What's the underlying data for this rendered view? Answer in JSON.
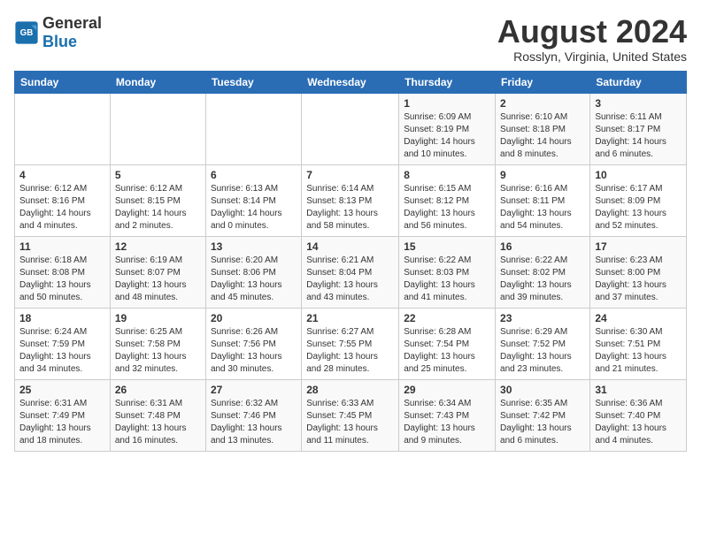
{
  "logo": {
    "general": "General",
    "blue": "Blue"
  },
  "title": "August 2024",
  "subtitle": "Rosslyn, Virginia, United States",
  "days_of_week": [
    "Sunday",
    "Monday",
    "Tuesday",
    "Wednesday",
    "Thursday",
    "Friday",
    "Saturday"
  ],
  "weeks": [
    [
      {
        "day": "",
        "info": ""
      },
      {
        "day": "",
        "info": ""
      },
      {
        "day": "",
        "info": ""
      },
      {
        "day": "",
        "info": ""
      },
      {
        "day": "1",
        "info": "Sunrise: 6:09 AM\nSunset: 8:19 PM\nDaylight: 14 hours\nand 10 minutes."
      },
      {
        "day": "2",
        "info": "Sunrise: 6:10 AM\nSunset: 8:18 PM\nDaylight: 14 hours\nand 8 minutes."
      },
      {
        "day": "3",
        "info": "Sunrise: 6:11 AM\nSunset: 8:17 PM\nDaylight: 14 hours\nand 6 minutes."
      }
    ],
    [
      {
        "day": "4",
        "info": "Sunrise: 6:12 AM\nSunset: 8:16 PM\nDaylight: 14 hours\nand 4 minutes."
      },
      {
        "day": "5",
        "info": "Sunrise: 6:12 AM\nSunset: 8:15 PM\nDaylight: 14 hours\nand 2 minutes."
      },
      {
        "day": "6",
        "info": "Sunrise: 6:13 AM\nSunset: 8:14 PM\nDaylight: 14 hours\nand 0 minutes."
      },
      {
        "day": "7",
        "info": "Sunrise: 6:14 AM\nSunset: 8:13 PM\nDaylight: 13 hours\nand 58 minutes."
      },
      {
        "day": "8",
        "info": "Sunrise: 6:15 AM\nSunset: 8:12 PM\nDaylight: 13 hours\nand 56 minutes."
      },
      {
        "day": "9",
        "info": "Sunrise: 6:16 AM\nSunset: 8:11 PM\nDaylight: 13 hours\nand 54 minutes."
      },
      {
        "day": "10",
        "info": "Sunrise: 6:17 AM\nSunset: 8:09 PM\nDaylight: 13 hours\nand 52 minutes."
      }
    ],
    [
      {
        "day": "11",
        "info": "Sunrise: 6:18 AM\nSunset: 8:08 PM\nDaylight: 13 hours\nand 50 minutes."
      },
      {
        "day": "12",
        "info": "Sunrise: 6:19 AM\nSunset: 8:07 PM\nDaylight: 13 hours\nand 48 minutes."
      },
      {
        "day": "13",
        "info": "Sunrise: 6:20 AM\nSunset: 8:06 PM\nDaylight: 13 hours\nand 45 minutes."
      },
      {
        "day": "14",
        "info": "Sunrise: 6:21 AM\nSunset: 8:04 PM\nDaylight: 13 hours\nand 43 minutes."
      },
      {
        "day": "15",
        "info": "Sunrise: 6:22 AM\nSunset: 8:03 PM\nDaylight: 13 hours\nand 41 minutes."
      },
      {
        "day": "16",
        "info": "Sunrise: 6:22 AM\nSunset: 8:02 PM\nDaylight: 13 hours\nand 39 minutes."
      },
      {
        "day": "17",
        "info": "Sunrise: 6:23 AM\nSunset: 8:00 PM\nDaylight: 13 hours\nand 37 minutes."
      }
    ],
    [
      {
        "day": "18",
        "info": "Sunrise: 6:24 AM\nSunset: 7:59 PM\nDaylight: 13 hours\nand 34 minutes."
      },
      {
        "day": "19",
        "info": "Sunrise: 6:25 AM\nSunset: 7:58 PM\nDaylight: 13 hours\nand 32 minutes."
      },
      {
        "day": "20",
        "info": "Sunrise: 6:26 AM\nSunset: 7:56 PM\nDaylight: 13 hours\nand 30 minutes."
      },
      {
        "day": "21",
        "info": "Sunrise: 6:27 AM\nSunset: 7:55 PM\nDaylight: 13 hours\nand 28 minutes."
      },
      {
        "day": "22",
        "info": "Sunrise: 6:28 AM\nSunset: 7:54 PM\nDaylight: 13 hours\nand 25 minutes."
      },
      {
        "day": "23",
        "info": "Sunrise: 6:29 AM\nSunset: 7:52 PM\nDaylight: 13 hours\nand 23 minutes."
      },
      {
        "day": "24",
        "info": "Sunrise: 6:30 AM\nSunset: 7:51 PM\nDaylight: 13 hours\nand 21 minutes."
      }
    ],
    [
      {
        "day": "25",
        "info": "Sunrise: 6:31 AM\nSunset: 7:49 PM\nDaylight: 13 hours\nand 18 minutes."
      },
      {
        "day": "26",
        "info": "Sunrise: 6:31 AM\nSunset: 7:48 PM\nDaylight: 13 hours\nand 16 minutes."
      },
      {
        "day": "27",
        "info": "Sunrise: 6:32 AM\nSunset: 7:46 PM\nDaylight: 13 hours\nand 13 minutes."
      },
      {
        "day": "28",
        "info": "Sunrise: 6:33 AM\nSunset: 7:45 PM\nDaylight: 13 hours\nand 11 minutes."
      },
      {
        "day": "29",
        "info": "Sunrise: 6:34 AM\nSunset: 7:43 PM\nDaylight: 13 hours\nand 9 minutes."
      },
      {
        "day": "30",
        "info": "Sunrise: 6:35 AM\nSunset: 7:42 PM\nDaylight: 13 hours\nand 6 minutes."
      },
      {
        "day": "31",
        "info": "Sunrise: 6:36 AM\nSunset: 7:40 PM\nDaylight: 13 hours\nand 4 minutes."
      }
    ]
  ]
}
